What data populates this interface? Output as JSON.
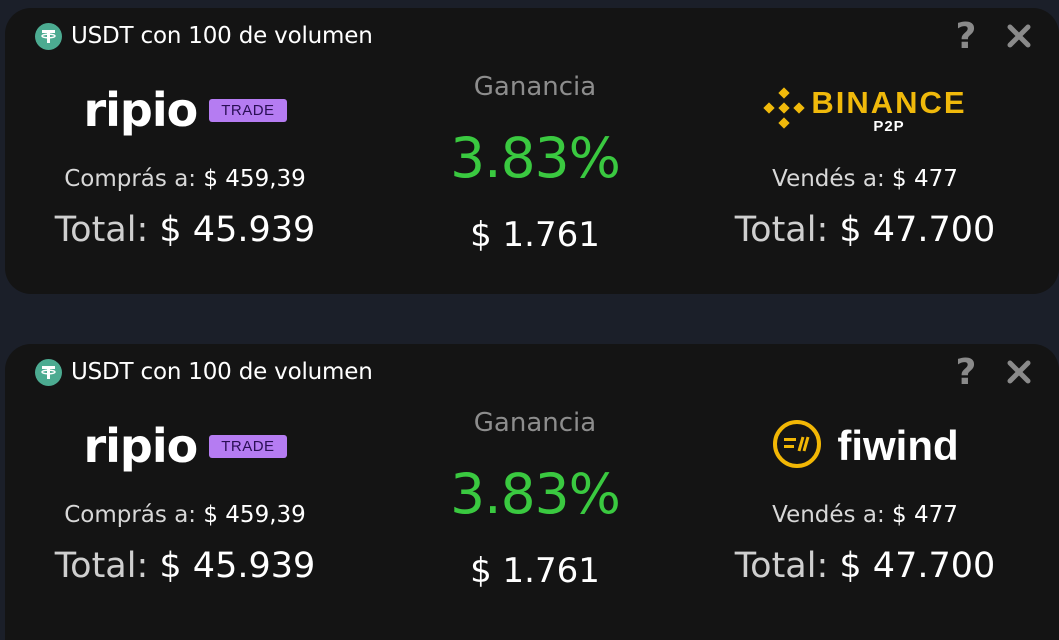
{
  "cards": [
    {
      "title": "USDT con 100 de volumen",
      "help_symbol": "?",
      "buy": {
        "exchange": "ripio",
        "badge": "TRADE",
        "price_label": "Comprás a:",
        "price_value": "$ 459,39",
        "total_label": "Total:",
        "total_value": "$ 45.939"
      },
      "gain": {
        "label": "Ganancia",
        "percent": "3.83%",
        "amount": "$ 1.761"
      },
      "sell": {
        "exchange_name": "BINANCE",
        "exchange_sub": "P2P",
        "price_label": "Vendés a:",
        "price_value": "$ 477",
        "total_label": "Total:",
        "total_value": "$ 47.700"
      }
    },
    {
      "title": "USDT con 100 de volumen",
      "help_symbol": "?",
      "buy": {
        "exchange": "ripio",
        "badge": "TRADE",
        "price_label": "Comprás a:",
        "price_value": "$ 459,39",
        "total_label": "Total:",
        "total_value": "$ 45.939"
      },
      "gain": {
        "label": "Ganancia",
        "percent": "3.83%",
        "amount": "$ 1.761"
      },
      "sell": {
        "exchange_name": "fiwind",
        "price_label": "Vendés a:",
        "price_value": "$ 477",
        "total_label": "Total:",
        "total_value": "$ 47.700"
      }
    }
  ],
  "colors": {
    "background": "#1b1f29",
    "card": "#141414",
    "gain_green": "#3ac940",
    "tether_green": "#4cab91",
    "binance_yellow": "#f0b90b",
    "ripio_badge": "#b57cf2",
    "fiwind_yellow": "#f2b705"
  },
  "icons": [
    "tether-icon",
    "help-icon",
    "close-icon",
    "binance-diamond-icon",
    "fiwind-icon"
  ]
}
